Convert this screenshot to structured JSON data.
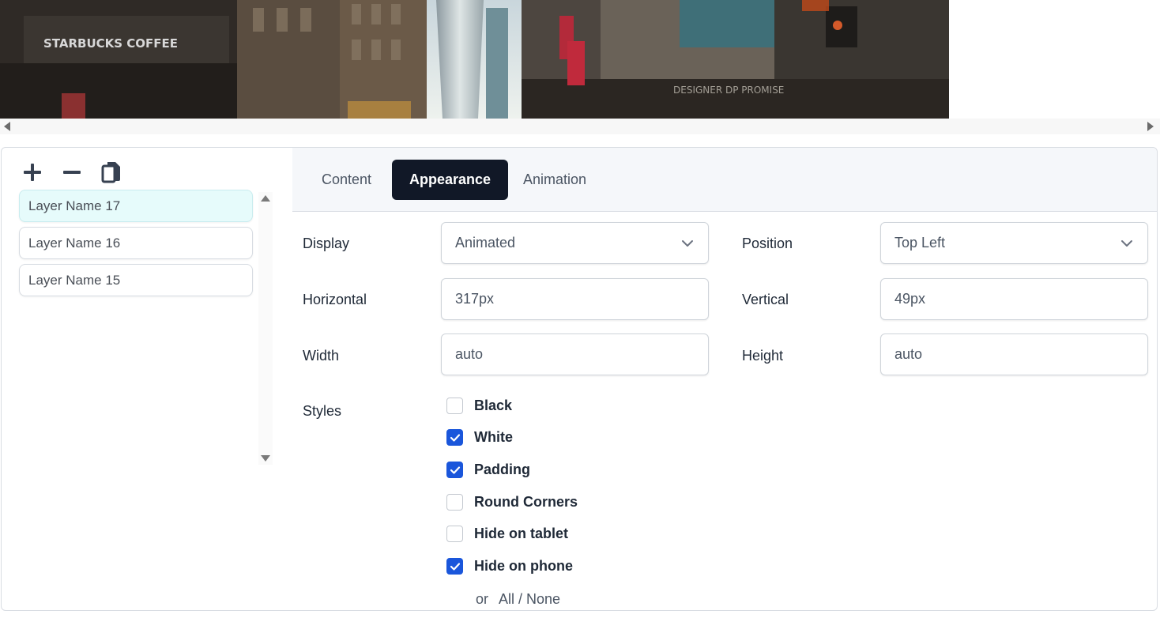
{
  "toolbar": {
    "add_icon": "plus-icon",
    "remove_icon": "minus-icon",
    "copy_icon": "copy-icon"
  },
  "layers": [
    {
      "name": "Layer Name 17",
      "active": true
    },
    {
      "name": "Layer Name 16",
      "active": false
    },
    {
      "name": "Layer Name 15",
      "active": false
    }
  ],
  "tabs": {
    "content": "Content",
    "appearance": "Appearance",
    "animation": "Animation",
    "active": "Appearance"
  },
  "form": {
    "display_label": "Display",
    "display_value": "Animated",
    "position_label": "Position",
    "position_value": "Top Left",
    "horizontal_label": "Horizontal",
    "horizontal_value": "317px",
    "vertical_label": "Vertical",
    "vertical_value": "49px",
    "width_label": "Width",
    "width_value": "auto",
    "height_label": "Height",
    "height_value": "auto",
    "styles_label": "Styles"
  },
  "styles": [
    {
      "label": "Black",
      "checked": false
    },
    {
      "label": "White",
      "checked": true
    },
    {
      "label": "Padding",
      "checked": true
    },
    {
      "label": "Round Corners",
      "checked": false
    },
    {
      "label": "Hide on tablet",
      "checked": false
    },
    {
      "label": "Hide on phone",
      "checked": true
    }
  ],
  "select_helpers": {
    "or": "or",
    "all_none": "All / None"
  },
  "colors": {
    "accent": "#1a56db",
    "active_tab": "#111827",
    "active_layer": "#e6fbfb"
  }
}
